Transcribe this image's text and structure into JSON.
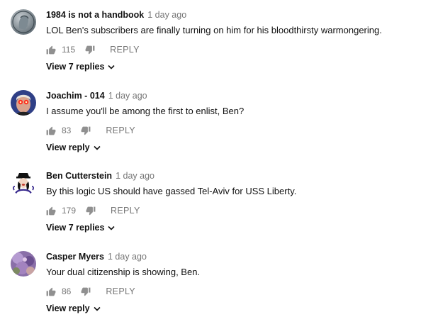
{
  "comments": [
    {
      "author": "1984 is not a handbook",
      "time": "1 day ago",
      "text": "LOL Ben's subscribers are finally turning on him for his bloodthirsty warmongering.",
      "likes": "115",
      "reply_label": "REPLY",
      "view_replies": "View 7 replies",
      "avatar_icon": "coin-portrait-icon"
    },
    {
      "author": "Joachim - 014",
      "time": "1 day ago",
      "text": "I assume you'll be among the first to enlist, Ben?",
      "likes": "83",
      "reply_label": "REPLY",
      "view_replies": "View reply",
      "avatar_icon": "laser-eyes-portrait-icon"
    },
    {
      "author": "Ben Cutterstein",
      "time": "1 day ago",
      "text": "By this logic US should have gassed Tel-Aviv for USS Liberty.",
      "likes": "179",
      "reply_label": "REPLY",
      "view_replies": "View 7 replies",
      "avatar_icon": "cartoon-character-icon"
    },
    {
      "author": "Casper Myers",
      "time": "1 day ago",
      "text": "Your dual citizenship is showing, Ben.",
      "likes": "86",
      "reply_label": "REPLY",
      "view_replies": "View reply",
      "avatar_icon": "purple-photo-icon"
    }
  ],
  "colors": {
    "text": "#111111",
    "secondary": "#767676",
    "icon": "#909090"
  }
}
